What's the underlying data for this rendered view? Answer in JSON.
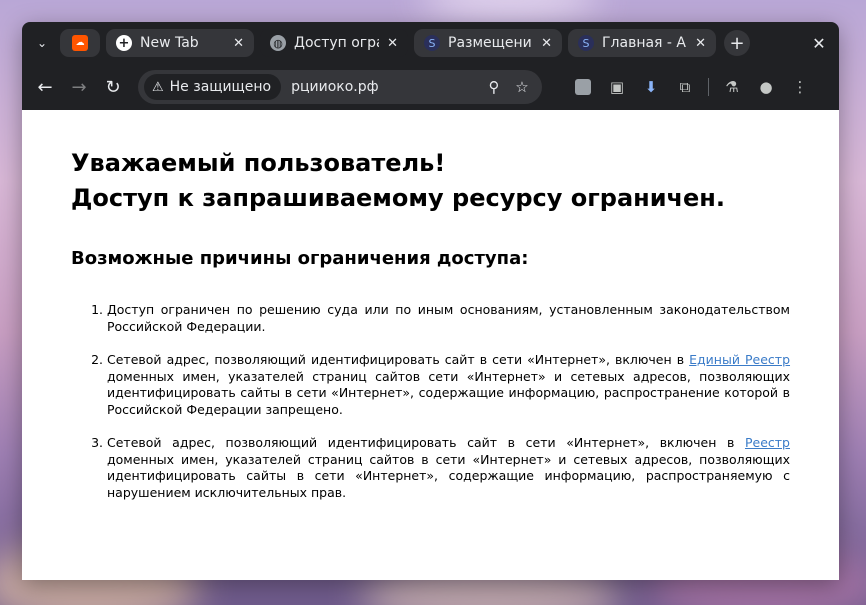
{
  "colors": {
    "window_bg": "#202124",
    "tab_bg": "#35363a",
    "link": "#3a7bc8",
    "page_bg": "#ffffff"
  },
  "tabs": [
    {
      "title": "",
      "favicon": "soundcloud-icon",
      "active": false
    },
    {
      "title": "New Tab",
      "favicon": "plus-circle-icon",
      "active": false
    },
    {
      "title": "Доступ огра",
      "favicon": "globe-icon",
      "active": true
    },
    {
      "title": "Размещени",
      "favicon": "site-icon",
      "active": false
    },
    {
      "title": "Главная - А",
      "favicon": "site-icon",
      "active": false
    }
  ],
  "toolbar": {
    "security_label": "Не защищено",
    "url": "рцииоко.рф"
  },
  "page": {
    "heading_line1": "Уважаемый пользователь!",
    "heading_line2": "Доступ к запрашиваемому ресурсу ограничен.",
    "subheading": "Возможные причины ограничения доступа:",
    "reason1": "Доступ ограничен по решению суда или по иным основаниям, установленным законодательством Российской Федерации.",
    "reason2_before": "Сетевой адрес, позволяющий идентифицировать сайт в сети «Интернет», включен в ",
    "reason2_link": "Единый Реестр",
    "reason2_after": " доменных имен, указателей страниц сайтов сети «Интернет» и сетевых адресов, позволяющих идентифицировать сайты в сети «Интернет», содержащие информацию, распространение которой в Российской Федерации запрещено.",
    "reason3_before": "Сетевой адрес, позволяющий идентифицировать сайт в сети «Интернет», включен в ",
    "reason3_link": "Реестр",
    "reason3_after": " доменных имен, указателей страниц сайтов в сети «Интернет» и сетевых адресов, позволяющих идентифицировать сайты в сети «Интернет», содержащие информацию, распространяемую с нарушением исключительных прав."
  }
}
